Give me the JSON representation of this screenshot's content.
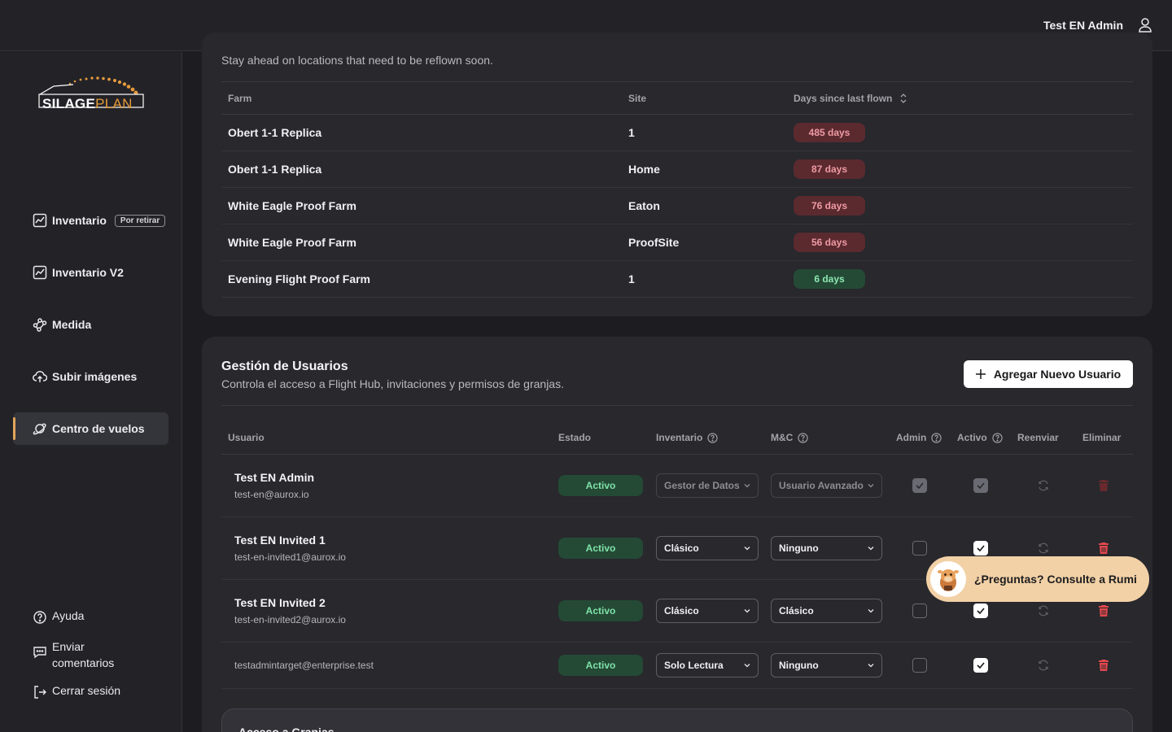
{
  "header": {
    "user_name": "Test EN Admin"
  },
  "sidebar": {
    "nav": [
      {
        "label": "Inventario",
        "tag": "Por retirar"
      },
      {
        "label": "Inventario V2"
      },
      {
        "label": "Medida"
      },
      {
        "label": "Subir imágenes"
      },
      {
        "label": "Centro de vuelos"
      }
    ],
    "bottom": [
      {
        "label": "Ayuda"
      },
      {
        "label": "Enviar comentarios",
        "line1": "Enviar",
        "line2": "comentarios"
      },
      {
        "label": "Cerrar sesión"
      }
    ]
  },
  "reflown": {
    "subtitle": "Stay ahead on locations that need to be reflown soon.",
    "columns": {
      "farm": "Farm",
      "site": "Site",
      "days": "Days since last flown"
    },
    "rows": [
      {
        "farm": "Obert 1-1 Replica",
        "site": "1",
        "days": "485 days",
        "level": "red"
      },
      {
        "farm": "Obert 1-1 Replica",
        "site": "Home",
        "days": "87 days",
        "level": "red"
      },
      {
        "farm": "White Eagle Proof Farm",
        "site": "Eaton",
        "days": "76 days",
        "level": "red"
      },
      {
        "farm": "White Eagle Proof Farm",
        "site": "ProofSite",
        "days": "56 days",
        "level": "red"
      },
      {
        "farm": "Evening Flight Proof Farm",
        "site": "1",
        "days": "6 days",
        "level": "green"
      }
    ]
  },
  "users": {
    "title": "Gestión de Usuarios",
    "subtitle": "Controla el acceso a Flight Hub, invitaciones y permisos de granjas.",
    "add_button": "Agregar Nuevo Usuario",
    "columns": {
      "user": "Usuario",
      "status": "Estado",
      "inventory": "Inventario",
      "mc": "M&C",
      "admin": "Admin",
      "active": "Activo",
      "resend": "Reenviar",
      "delete": "Eliminar"
    },
    "rows": [
      {
        "name": "Test EN Admin",
        "email": "test-en@aurox.io",
        "status": "Activo",
        "inventory": "Gestor de Datos",
        "mc": "Usuario Avanzado",
        "admin": true,
        "active": true,
        "disabled": true
      },
      {
        "name": "Test EN Invited 1",
        "email": "test-en-invited1@aurox.io",
        "status": "Activo",
        "inventory": "Clásico",
        "mc": "Ninguno",
        "admin": false,
        "active": true,
        "disabled": false
      },
      {
        "name": "Test EN Invited 2",
        "email": "test-en-invited2@aurox.io",
        "status": "Activo",
        "inventory": "Clásico",
        "mc": "Clásico",
        "admin": false,
        "active": true,
        "disabled": false
      },
      {
        "name": "",
        "email": "testadmintarget@enterprise.test",
        "status": "Activo",
        "inventory": "Solo Lectura",
        "mc": "Ninguno",
        "admin": false,
        "active": true,
        "disabled": false
      }
    ]
  },
  "farm_access": {
    "title": "Acceso a Granjas"
  },
  "chat": {
    "label": "¿Preguntas? Consulte a Rumi"
  },
  "colors": {
    "accent": "#e2a55c",
    "danger": "#e5484d",
    "success": "#7fe3a8"
  }
}
